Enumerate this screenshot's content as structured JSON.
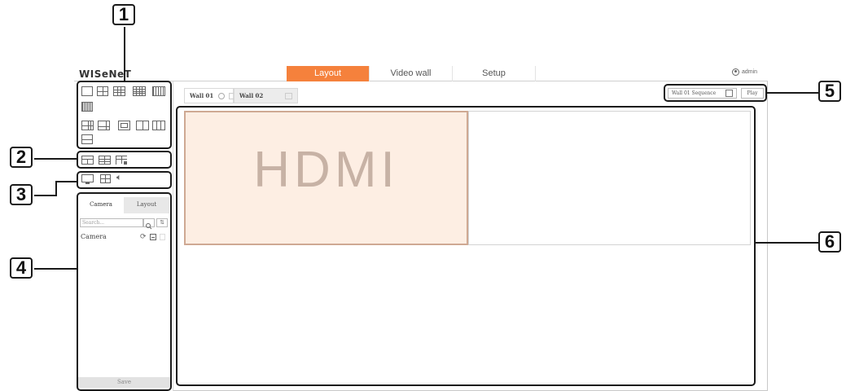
{
  "brand": {
    "logo": "WISeNeT"
  },
  "top_tabs": [
    {
      "label": "Layout",
      "active": true
    },
    {
      "label": "Video wall",
      "active": false
    },
    {
      "label": "Setup",
      "active": false
    }
  ],
  "user": {
    "name": "admin",
    "icon": "user-icon"
  },
  "wall_tabs": [
    {
      "label": "Wall 01",
      "active": true
    },
    {
      "label": "Wall 02",
      "active": false
    }
  ],
  "sequence": {
    "selected": "Wall 01 Sequence",
    "play_label": "Play"
  },
  "side_tabs": [
    {
      "label": "Camera",
      "active": true
    },
    {
      "label": "Layout",
      "active": false
    }
  ],
  "search": {
    "placeholder": "Search..."
  },
  "tree": {
    "camera_label": "Camera"
  },
  "save_label": "Save",
  "display": {
    "tile_label": "HDMI"
  },
  "callouts": [
    "1",
    "2",
    "3",
    "4",
    "5",
    "6"
  ],
  "colors": {
    "accent": "#f5813c",
    "tile_bg": "#fdeee3"
  }
}
